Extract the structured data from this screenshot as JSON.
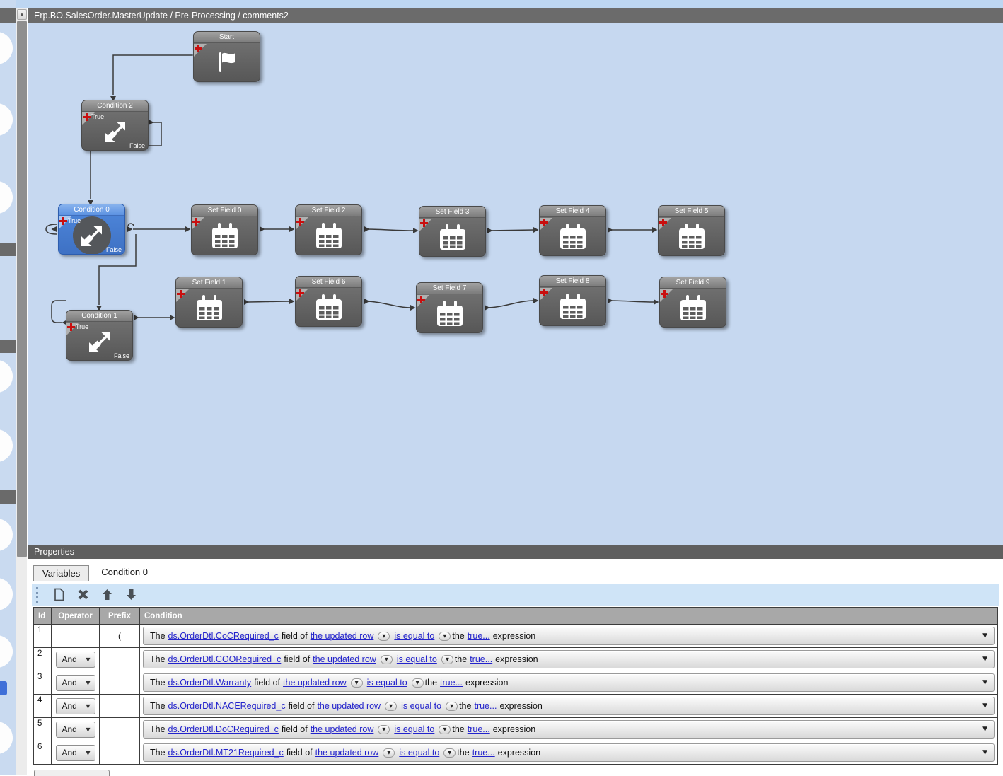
{
  "window": {
    "title": "Erp.BO.SalesOrder.MasterUpdate / Pre-Processing / comments2"
  },
  "colors": {
    "canvas_background": "#c6d8f0",
    "selected_node_blue": "#4f88dc",
    "node_gray": "#676767",
    "link_blue": "#2323cc",
    "toolbar_blue": "#cfe4f7",
    "add_plus_red": "#c90f0f"
  },
  "canvas": {
    "nodes": [
      {
        "label": "Start",
        "type": "start",
        "icon": "flag-icon"
      },
      {
        "label": "Condition 2",
        "type": "condition",
        "icon": "condition-arrows-icon",
        "true_label": "True",
        "false_label": "False"
      },
      {
        "label": "Condition 0",
        "type": "condition",
        "icon": "condition-arrows-icon",
        "true_label": "True",
        "false_label": "False",
        "selected": true
      },
      {
        "label": "Set Field 0",
        "type": "setfield",
        "icon": "set-field-icon"
      },
      {
        "label": "Set Field 2",
        "type": "setfield",
        "icon": "set-field-icon"
      },
      {
        "label": "Set Field 3",
        "type": "setfield",
        "icon": "set-field-icon"
      },
      {
        "label": "Set Field 4",
        "type": "setfield",
        "icon": "set-field-icon"
      },
      {
        "label": "Set Field 5",
        "type": "setfield",
        "icon": "set-field-icon"
      },
      {
        "label": "Condition 1",
        "type": "condition",
        "icon": "condition-arrows-icon",
        "true_label": "True",
        "false_label": "False"
      },
      {
        "label": "Set Field 1",
        "type": "setfield",
        "icon": "set-field-icon"
      },
      {
        "label": "Set Field 6",
        "type": "setfield",
        "icon": "set-field-icon"
      },
      {
        "label": "Set Field 7",
        "type": "setfield",
        "icon": "set-field-icon"
      },
      {
        "label": "Set Field 8",
        "type": "setfield",
        "icon": "set-field-icon"
      },
      {
        "label": "Set Field 9",
        "type": "setfield",
        "icon": "set-field-icon"
      }
    ]
  },
  "properties": {
    "title": "Properties",
    "tabs": [
      {
        "label": "Variables",
        "active": false
      },
      {
        "label": "Condition 0",
        "active": true
      }
    ],
    "toolbar_icons": [
      "new-row-icon",
      "delete-row-icon",
      "move-up-icon",
      "move-down-icon"
    ],
    "table": {
      "columns": [
        "Id",
        "Operator",
        "Prefix",
        "Condition"
      ],
      "sentence": {
        "pre": "The",
        "mid1": "field of",
        "mid2": "the",
        "post": "expression"
      },
      "rows": [
        {
          "id": "1",
          "operator": "",
          "prefix": "(",
          "field": "ds.OrderDtl.CoCRequired_c",
          "row_target": "the updated row",
          "comparator": "is equal to",
          "value": "true..."
        },
        {
          "id": "2",
          "operator": "And",
          "prefix": "",
          "field": "ds.OrderDtl.COORequired_c",
          "row_target": "the updated row",
          "comparator": "is equal to",
          "value": "true..."
        },
        {
          "id": "3",
          "operator": "And",
          "prefix": "",
          "field": "ds.OrderDtl.Warranty",
          "row_target": "the updated row",
          "comparator": "is equal to",
          "value": "true..."
        },
        {
          "id": "4",
          "operator": "And",
          "prefix": "",
          "field": "ds.OrderDtl.NACERequired_c",
          "row_target": "the updated row",
          "comparator": "is equal to",
          "value": "true..."
        },
        {
          "id": "5",
          "operator": "And",
          "prefix": "",
          "field": "ds.OrderDtl.DoCRequired_c",
          "row_target": "the updated row",
          "comparator": "is equal to",
          "value": "true..."
        },
        {
          "id": "6",
          "operator": "And",
          "prefix": "",
          "field": "ds.OrderDtl.MT21Required_c",
          "row_target": "the updated row",
          "comparator": "is equal to",
          "value": "true..."
        }
      ]
    }
  }
}
